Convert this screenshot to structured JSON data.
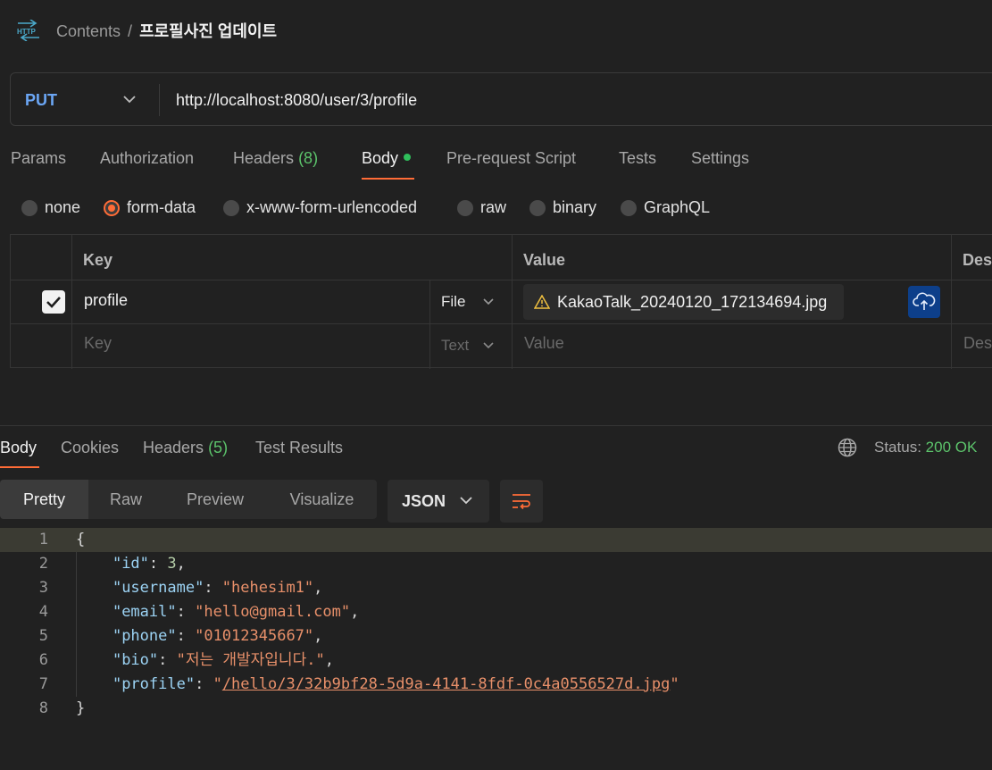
{
  "header": {
    "icon": "http-icon",
    "breadcrumb_parent": "Contents",
    "breadcrumb_sep": "/",
    "breadcrumb_current": "프로필사진 업데이트"
  },
  "request": {
    "method": "PUT",
    "url": "http://localhost:8080/user/3/profile"
  },
  "request_tabs": [
    {
      "label": "Params"
    },
    {
      "label": "Authorization"
    },
    {
      "label": "Headers",
      "count": "(8)"
    },
    {
      "label": "Body",
      "active": true
    },
    {
      "label": "Pre-request Script"
    },
    {
      "label": "Tests"
    },
    {
      "label": "Settings"
    }
  ],
  "body_types": [
    {
      "label": "none"
    },
    {
      "label": "form-data",
      "selected": true
    },
    {
      "label": "x-www-form-urlencoded"
    },
    {
      "label": "raw"
    },
    {
      "label": "binary"
    },
    {
      "label": "GraphQL"
    }
  ],
  "form_table": {
    "headers": {
      "key": "Key",
      "value": "Value",
      "description": "Des"
    },
    "rows": [
      {
        "checked": true,
        "key": "profile",
        "type": "File",
        "value": "KakaoTalk_20240120_172134694.jpg"
      }
    ],
    "empty_row": {
      "key_placeholder": "Key",
      "type": "Text",
      "value_placeholder": "Value",
      "description_placeholder": "Des"
    }
  },
  "response_tabs": [
    {
      "label": "Body",
      "active": true
    },
    {
      "label": "Cookies"
    },
    {
      "label": "Headers",
      "count": "(5)"
    },
    {
      "label": "Test Results"
    }
  ],
  "response_status": {
    "label": "Status:",
    "value": "200 OK"
  },
  "view_modes": [
    "Pretty",
    "Raw",
    "Preview",
    "Visualize"
  ],
  "format": "JSON",
  "line_numbers": [
    "1",
    "2",
    "3",
    "4",
    "5",
    "6",
    "7",
    "8"
  ],
  "response_json": {
    "open": "{",
    "close": "}",
    "fields": [
      {
        "key": "\"id\"",
        "value": "3",
        "type": "number"
      },
      {
        "key": "\"username\"",
        "value": "\"hehesim1\"",
        "type": "string"
      },
      {
        "key": "\"email\"",
        "value": "\"hello@gmail.com\"",
        "type": "string"
      },
      {
        "key": "\"phone\"",
        "value": "\"01012345667\"",
        "type": "string"
      },
      {
        "key": "\"bio\"",
        "value": "\"저는 개발자입니다.\"",
        "type": "string"
      },
      {
        "key": "\"profile\"",
        "value_quote": "\"",
        "value_link": "/hello/3/32b9bf28-5d9a-4141-8fdf-0c4a0556527d.jpg",
        "type": "link"
      }
    ]
  },
  "colors": {
    "accent": "#ff6c37",
    "method": "#6ba6f4",
    "success": "#5cc36b",
    "upload": "#0d3f8a"
  }
}
